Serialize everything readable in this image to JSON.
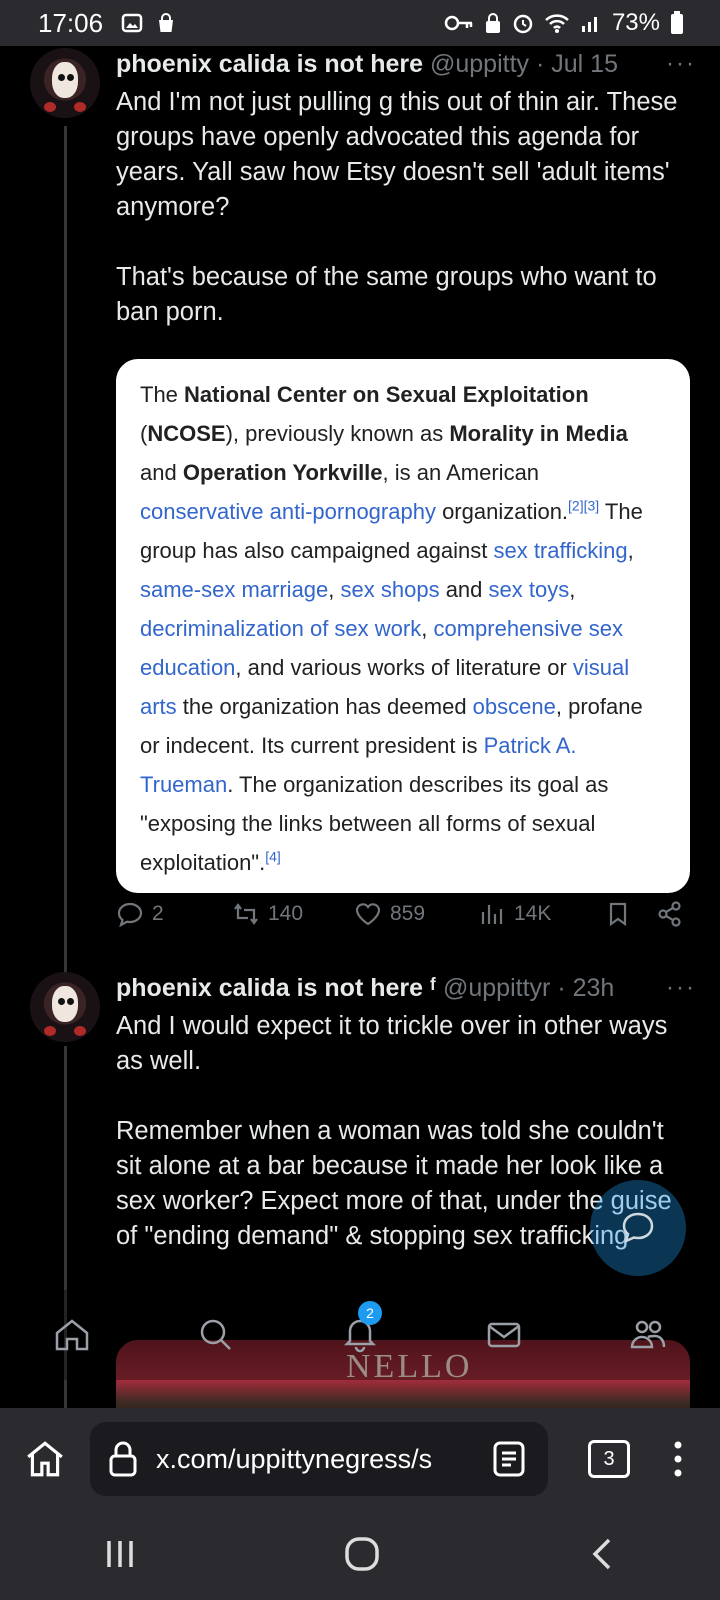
{
  "status_bar": {
    "time": "17:06",
    "battery": "73%",
    "left_icons": [
      "gallery-icon",
      "shopping-bag-icon"
    ],
    "right_icons": [
      "key-icon",
      "vpn-lock-icon",
      "alarm-icon",
      "wifi-icon",
      "signal-icon",
      "battery-icon"
    ]
  },
  "posts": [
    {
      "name": "phoenix calida is not here",
      "handle": "@uppitty",
      "time": "· Jul 15",
      "more": "···",
      "text": "And I'm not just pulling g this out of thin air. These groups have openly advocated this agenda for years. Yall saw how Etsy doesn't sell 'adult items' anymore?\n\nThat's because of the same groups who want to ban porn.",
      "card": {
        "p1": "The ",
        "b1": "National Center on Sexual Exploitation",
        "p2": " (",
        "b2": "NCOSE",
        "p3": "), previously known as ",
        "b3": "Morality in Media",
        "p4": " and ",
        "b4": "Operation Yorkville",
        "p5": ", is an American ",
        "l1": "conservative anti-pornography",
        "p6": " organization.",
        "s1": "[2][3]",
        "p7": " The group has also campaigned against ",
        "l2": "sex trafficking",
        "p8": ", ",
        "l3": "same-sex marriage",
        "p9": ", ",
        "l4": "sex shops",
        "p10": " and ",
        "l5": "sex toys",
        "p11": ", ",
        "l6": "decriminalization of sex work",
        "p12": ", ",
        "l7": "comprehensive sex education",
        "p13": ", and various works of literature or ",
        "l8": "visual arts",
        "p14": " the organization has deemed ",
        "l9": "obscene",
        "p15": ", profane or indecent. Its current president is ",
        "l10": "Patrick A. Trueman",
        "p16": ". The organization describes its goal as \"exposing the links between all forms of sexual exploitation\".",
        "s2": "[4]"
      },
      "actions": {
        "replies": "2",
        "reposts": "140",
        "likes": "859",
        "views": "14K"
      }
    },
    {
      "name": "phoenix calida is not here ᶠ",
      "handle": "@uppittyr",
      "time": "· 23h",
      "more": "···",
      "text": "And I would expect it to trickle over in other ways as well.\n\nRemember when a woman was told she couldn't sit alone at a bar because it made her look like a sex worker? Expect more of that, under the guise of \"ending demand\" & stopping sex trafficking",
      "image_sign": "NELLO"
    }
  ],
  "bottom_nav": {
    "items": [
      "home-icon",
      "search-icon",
      "notifications-icon",
      "messages-icon",
      "communities-icon"
    ],
    "notification_badge": "2"
  },
  "browser": {
    "url": "x.com/uppittynegress/s",
    "tabs_count": "3"
  },
  "colors": {
    "background": "#000000",
    "link": "#3366cc",
    "muted": "#71767b",
    "accent": "#1d9bf0"
  }
}
